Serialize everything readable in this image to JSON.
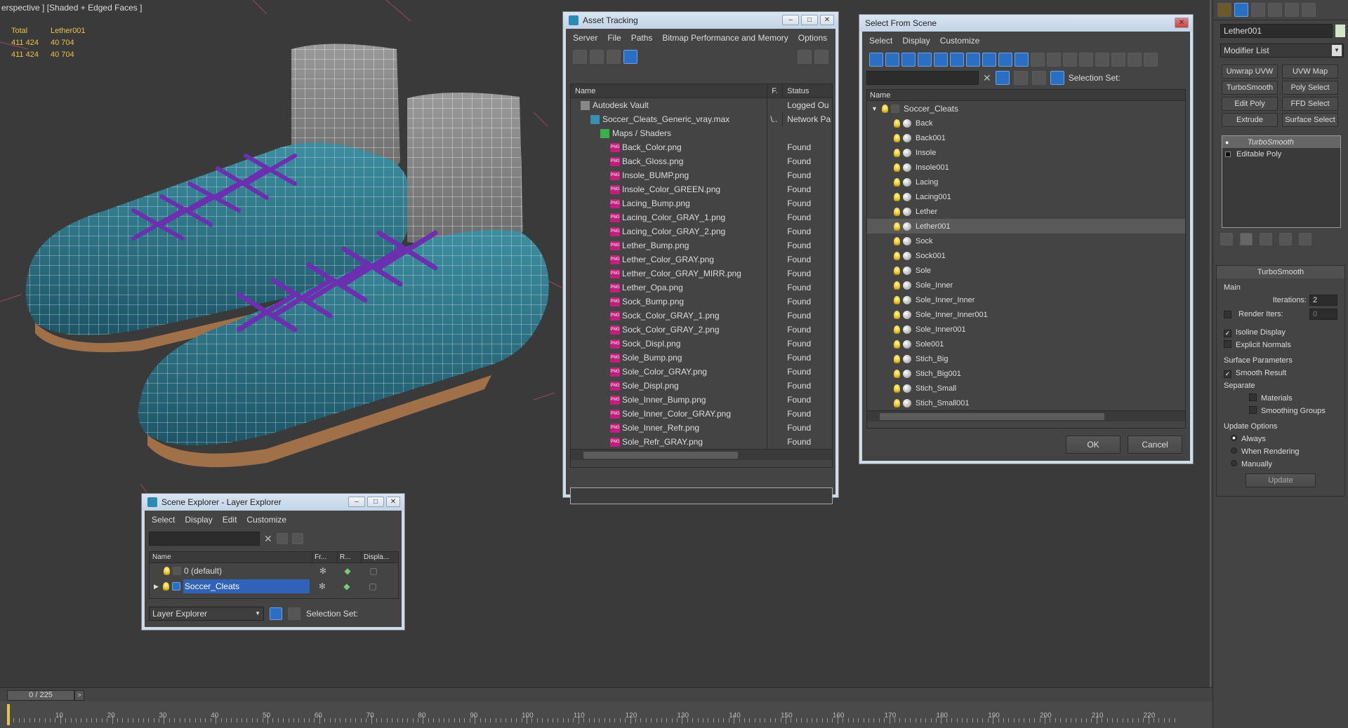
{
  "viewport": {
    "label": "erspective ] [Shaded + Edged Faces ]",
    "stats": {
      "header": [
        "Total",
        "Lether001"
      ],
      "rows": [
        [
          "411 424",
          "40 704"
        ],
        [
          "411 424",
          "40 704"
        ]
      ]
    }
  },
  "asset_tracking": {
    "title": "Asset Tracking",
    "menu": [
      "Server",
      "File",
      "Paths",
      "Bitmap Performance and Memory",
      "Options"
    ],
    "columns": [
      "Name",
      "F.",
      "Status"
    ],
    "rows": [
      {
        "name": "Autodesk Vault",
        "f": "",
        "status": "Logged Ou",
        "indent": 1,
        "icon": "vault"
      },
      {
        "name": "Soccer_Cleats_Generic_vray.max",
        "f": "\\..",
        "status": "Network Pa",
        "indent": 2,
        "icon": "max"
      },
      {
        "name": "Maps / Shaders",
        "f": "",
        "status": "",
        "indent": 3,
        "icon": "maps"
      },
      {
        "name": "Back_Color.png",
        "f": "",
        "status": "Found",
        "indent": 4,
        "icon": "png"
      },
      {
        "name": "Back_Gloss.png",
        "f": "",
        "status": "Found",
        "indent": 4,
        "icon": "png"
      },
      {
        "name": "Insole_BUMP.png",
        "f": "",
        "status": "Found",
        "indent": 4,
        "icon": "png"
      },
      {
        "name": "Insole_Color_GREEN.png",
        "f": "",
        "status": "Found",
        "indent": 4,
        "icon": "png"
      },
      {
        "name": "Lacing_Bump.png",
        "f": "",
        "status": "Found",
        "indent": 4,
        "icon": "png"
      },
      {
        "name": "Lacing_Color_GRAY_1.png",
        "f": "",
        "status": "Found",
        "indent": 4,
        "icon": "png"
      },
      {
        "name": "Lacing_Color_GRAY_2.png",
        "f": "",
        "status": "Found",
        "indent": 4,
        "icon": "png"
      },
      {
        "name": "Lether_Bump.png",
        "f": "",
        "status": "Found",
        "indent": 4,
        "icon": "png"
      },
      {
        "name": "Lether_Color_GRAY.png",
        "f": "",
        "status": "Found",
        "indent": 4,
        "icon": "png"
      },
      {
        "name": "Lether_Color_GRAY_MIRR.png",
        "f": "",
        "status": "Found",
        "indent": 4,
        "icon": "png"
      },
      {
        "name": "Lether_Opa.png",
        "f": "",
        "status": "Found",
        "indent": 4,
        "icon": "png"
      },
      {
        "name": "Sock_Bump.png",
        "f": "",
        "status": "Found",
        "indent": 4,
        "icon": "png"
      },
      {
        "name": "Sock_Color_GRAY_1.png",
        "f": "",
        "status": "Found",
        "indent": 4,
        "icon": "png"
      },
      {
        "name": "Sock_Color_GRAY_2.png",
        "f": "",
        "status": "Found",
        "indent": 4,
        "icon": "png"
      },
      {
        "name": "Sock_Displ.png",
        "f": "",
        "status": "Found",
        "indent": 4,
        "icon": "png"
      },
      {
        "name": "Sole_Bump.png",
        "f": "",
        "status": "Found",
        "indent": 4,
        "icon": "png"
      },
      {
        "name": "Sole_Color_GRAY.png",
        "f": "",
        "status": "Found",
        "indent": 4,
        "icon": "png"
      },
      {
        "name": "Sole_Displ.png",
        "f": "",
        "status": "Found",
        "indent": 4,
        "icon": "png"
      },
      {
        "name": "Sole_Inner_Bump.png",
        "f": "",
        "status": "Found",
        "indent": 4,
        "icon": "png"
      },
      {
        "name": "Sole_Inner_Color_GRAY.png",
        "f": "",
        "status": "Found",
        "indent": 4,
        "icon": "png"
      },
      {
        "name": "Sole_Inner_Refr.png",
        "f": "",
        "status": "Found",
        "indent": 4,
        "icon": "png"
      },
      {
        "name": "Sole_Refr_GRAY.png",
        "f": "",
        "status": "Found",
        "indent": 4,
        "icon": "png"
      }
    ]
  },
  "select_from_scene": {
    "title": "Select From Scene",
    "menu": [
      "Select",
      "Display",
      "Customize"
    ],
    "selection_set_label": "Selection Set:",
    "column": "Name",
    "root": "Soccer_Cleats",
    "items": [
      "Back",
      "Back001",
      "Insole",
      "Insole001",
      "Lacing",
      "Lacing001",
      "Lether",
      "Lether001",
      "Sock",
      "Sock001",
      "Sole",
      "Sole_Inner",
      "Sole_Inner_Inner",
      "Sole_Inner_Inner001",
      "Sole_Inner001",
      "Sole001",
      "Stich_Big",
      "Stich_Big001",
      "Stich_Small",
      "Stich_Small001"
    ],
    "selected": "Lether001",
    "ok_label": "OK",
    "cancel_label": "Cancel"
  },
  "scene_explorer": {
    "title": "Scene Explorer - Layer Explorer",
    "menu": [
      "Select",
      "Display",
      "Edit",
      "Customize"
    ],
    "columns": [
      "Name",
      "Fr...",
      "R...",
      "Displa..."
    ],
    "rows": [
      "0 (default)",
      "Soccer_Cleats"
    ],
    "selected": "Soccer_Cleats",
    "mode": "Layer Explorer",
    "selection_set_label": "Selection Set:"
  },
  "command_panel": {
    "object_name": "Lether001",
    "modifier_list": "Modifier List",
    "modifier_buttons": [
      "Unwrap UVW",
      "UVW Map",
      "TurboSmooth",
      "Poly Select",
      "Edit Poly",
      "FFD Select",
      "Extrude",
      "Surface Select"
    ],
    "stack": [
      "TurboSmooth",
      "Editable Poly"
    ],
    "rollout_title": "TurboSmooth",
    "main_label": "Main",
    "iterations_label": "Iterations:",
    "iterations_value": "2",
    "render_iters_label": "Render Iters:",
    "render_iters_value": "0",
    "isoline_label": "Isoline Display",
    "explicit_normals_label": "Explicit Normals",
    "surface_params_label": "Surface Parameters",
    "smooth_result_label": "Smooth Result",
    "separate_label": "Separate",
    "materials_label": "Materials",
    "smoothing_groups_label": "Smoothing Groups",
    "update_options_label": "Update Options",
    "update_modes": [
      "Always",
      "When Rendering",
      "Manually"
    ],
    "update_button": "Update"
  },
  "timeline": {
    "frame_display": "0 / 225",
    "ticks": [
      "10",
      "20",
      "30",
      "40",
      "50",
      "60",
      "70",
      "80",
      "90",
      "100",
      "110",
      "120",
      "130",
      "140",
      "150",
      "160",
      "170",
      "180",
      "190",
      "200",
      "210",
      "220"
    ]
  }
}
